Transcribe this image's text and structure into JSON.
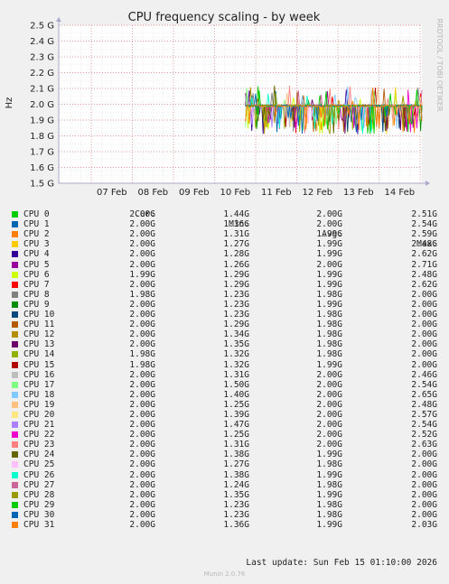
{
  "chart_data": {
    "type": "line",
    "title": "CPU frequency scaling - by week",
    "ylabel": "Hz",
    "ylim": [
      1.5,
      2.5
    ],
    "yticks": [
      "1.5 G",
      "1.6 G",
      "1.7 G",
      "1.8 G",
      "1.9 G",
      "2.0 G",
      "2.1 G",
      "2.2 G",
      "2.3 G",
      "2.4 G",
      "2.5 G"
    ],
    "xticks": [
      "07 Feb",
      "08 Feb",
      "09 Feb",
      "10 Feb",
      "11 Feb",
      "12 Feb",
      "13 Feb",
      "14 Feb"
    ],
    "xrange": [
      "2026-02-06T05:00",
      "2026-02-15T01:00"
    ],
    "data_start": "2026-02-10T18:00",
    "baseline": 1.99,
    "grid": true,
    "legend_placement": "bottom",
    "series": [
      {
        "name": "CPU 0",
        "color": "#00cc00",
        "cur": "2.00G",
        "min": "1.44G",
        "avg": "2.00G",
        "max": "2.51G"
      },
      {
        "name": "CPU 1",
        "color": "#0066b3",
        "cur": "2.00G",
        "min": "1.36G",
        "avg": "2.00G",
        "max": "2.54G"
      },
      {
        "name": "CPU 2",
        "color": "#ff8000",
        "cur": "2.00G",
        "min": "1.31G",
        "avg": "1.99G",
        "max": "2.59G"
      },
      {
        "name": "CPU 3",
        "color": "#ffcc00",
        "cur": "2.00G",
        "min": "1.27G",
        "avg": "1.99G",
        "max": "2.48G"
      },
      {
        "name": "CPU 4",
        "color": "#330099",
        "cur": "2.00G",
        "min": "1.28G",
        "avg": "1.99G",
        "max": "2.62G"
      },
      {
        "name": "CPU 5",
        "color": "#990099",
        "cur": "2.00G",
        "min": "1.26G",
        "avg": "2.00G",
        "max": "2.71G"
      },
      {
        "name": "CPU 6",
        "color": "#ccff00",
        "cur": "1.99G",
        "min": "1.29G",
        "avg": "1.99G",
        "max": "2.48G"
      },
      {
        "name": "CPU 7",
        "color": "#ff0000",
        "cur": "2.00G",
        "min": "1.29G",
        "avg": "1.99G",
        "max": "2.62G"
      },
      {
        "name": "CPU 8",
        "color": "#808080",
        "cur": "1.98G",
        "min": "1.23G",
        "avg": "1.98G",
        "max": "2.00G"
      },
      {
        "name": "CPU 9",
        "color": "#008f00",
        "cur": "2.00G",
        "min": "1.23G",
        "avg": "1.99G",
        "max": "2.00G"
      },
      {
        "name": "CPU 10",
        "color": "#00487d",
        "cur": "2.00G",
        "min": "1.23G",
        "avg": "1.98G",
        "max": "2.00G"
      },
      {
        "name": "CPU 11",
        "color": "#b35a00",
        "cur": "2.00G",
        "min": "1.29G",
        "avg": "1.98G",
        "max": "2.00G"
      },
      {
        "name": "CPU 12",
        "color": "#b38f00",
        "cur": "2.00G",
        "min": "1.34G",
        "avg": "1.98G",
        "max": "2.00G"
      },
      {
        "name": "CPU 13",
        "color": "#6b006b",
        "cur": "2.00G",
        "min": "1.35G",
        "avg": "1.98G",
        "max": "2.00G"
      },
      {
        "name": "CPU 14",
        "color": "#8fb300",
        "cur": "1.98G",
        "min": "1.32G",
        "avg": "1.98G",
        "max": "2.00G"
      },
      {
        "name": "CPU 15",
        "color": "#b30000",
        "cur": "1.98G",
        "min": "1.32G",
        "avg": "1.99G",
        "max": "2.00G"
      },
      {
        "name": "CPU 16",
        "color": "#bebebe",
        "cur": "2.00G",
        "min": "1.31G",
        "avg": "2.00G",
        "max": "2.46G"
      },
      {
        "name": "CPU 17",
        "color": "#80ff80",
        "cur": "2.00G",
        "min": "1.50G",
        "avg": "2.00G",
        "max": "2.54G"
      },
      {
        "name": "CPU 18",
        "color": "#80c9ff",
        "cur": "2.00G",
        "min": "1.40G",
        "avg": "2.00G",
        "max": "2.65G"
      },
      {
        "name": "CPU 19",
        "color": "#ffc080",
        "cur": "2.00G",
        "min": "1.25G",
        "avg": "2.00G",
        "max": "2.48G"
      },
      {
        "name": "CPU 20",
        "color": "#ffe680",
        "cur": "2.00G",
        "min": "1.39G",
        "avg": "2.00G",
        "max": "2.57G"
      },
      {
        "name": "CPU 21",
        "color": "#aa80ff",
        "cur": "2.00G",
        "min": "1.47G",
        "avg": "2.00G",
        "max": "2.54G"
      },
      {
        "name": "CPU 22",
        "color": "#ee00cc",
        "cur": "2.00G",
        "min": "1.25G",
        "avg": "2.00G",
        "max": "2.52G"
      },
      {
        "name": "CPU 23",
        "color": "#ff8080",
        "cur": "2.00G",
        "min": "1.31G",
        "avg": "2.00G",
        "max": "2.63G"
      },
      {
        "name": "CPU 24",
        "color": "#666600",
        "cur": "2.00G",
        "min": "1.38G",
        "avg": "1.99G",
        "max": "2.00G"
      },
      {
        "name": "CPU 25",
        "color": "#ffbfff",
        "cur": "2.00G",
        "min": "1.27G",
        "avg": "1.98G",
        "max": "2.00G"
      },
      {
        "name": "CPU 26",
        "color": "#00ffcc",
        "cur": "2.00G",
        "min": "1.38G",
        "avg": "1.99G",
        "max": "2.00G"
      },
      {
        "name": "CPU 27",
        "color": "#cc6699",
        "cur": "2.00G",
        "min": "1.24G",
        "avg": "1.98G",
        "max": "2.00G"
      },
      {
        "name": "CPU 28",
        "color": "#999900",
        "cur": "2.00G",
        "min": "1.35G",
        "avg": "1.99G",
        "max": "2.00G"
      },
      {
        "name": "CPU 29",
        "color": "#00cc00",
        "cur": "2.00G",
        "min": "1.23G",
        "avg": "1.98G",
        "max": "2.00G"
      },
      {
        "name": "CPU 30",
        "color": "#0066b3",
        "cur": "2.00G",
        "min": "1.23G",
        "avg": "1.98G",
        "max": "2.00G"
      },
      {
        "name": "CPU 31",
        "color": "#ff8000",
        "cur": "2.00G",
        "min": "1.36G",
        "avg": "1.99G",
        "max": "2.03G"
      }
    ]
  },
  "legend_headers": {
    "cur": "Cur:",
    "min": "Min:",
    "avg": "Avg:",
    "max": "Max:"
  },
  "last_update": "Last update: Sun Feb 15 01:10:00 2026",
  "side_label": "RRDTOOL / TOBI OETIKER",
  "footer": "Munin 2.0.76",
  "colors": {
    "background": "#f0f0f0",
    "plot": "#ffffff",
    "grid_major": "#e08080",
    "grid_minor": "#dddddd",
    "axis": "#aaaacc"
  }
}
